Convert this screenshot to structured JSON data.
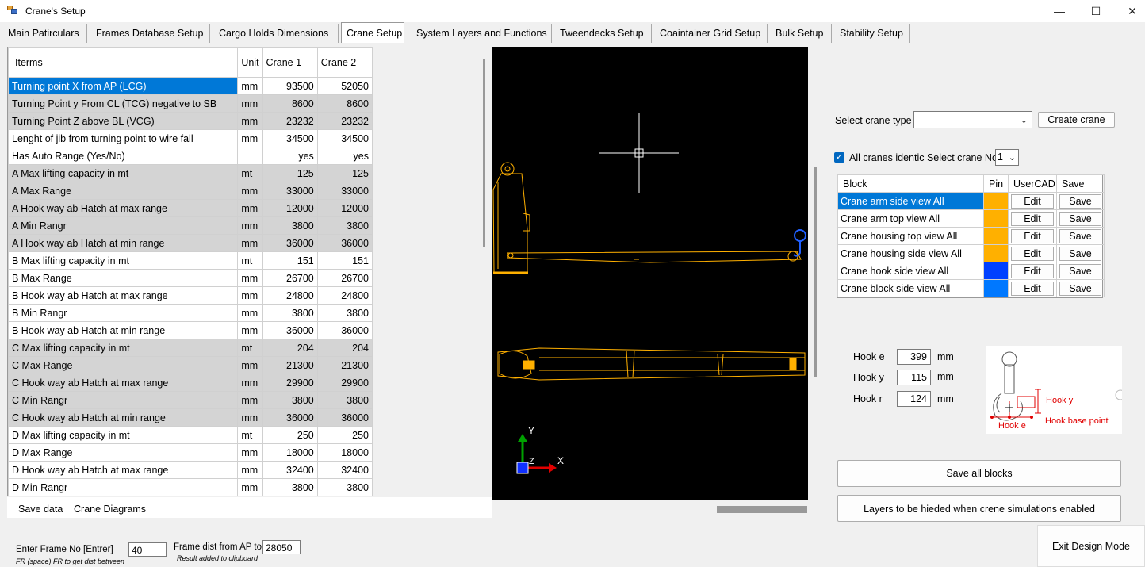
{
  "window": {
    "title": "Crane's Setup",
    "minimize": "—",
    "maximize": "☐",
    "close": "✕"
  },
  "tabs": [
    {
      "label": "Main Patirculars"
    },
    {
      "label": "Frames Database Setup"
    },
    {
      "label": "Cargo Holds Dimensions"
    },
    {
      "label": "Crane Setup"
    },
    {
      "label": "System Layers and Functions"
    },
    {
      "label": "Tweendecks Setup"
    },
    {
      "label": "Coaintainer Grid Setup"
    },
    {
      "label": "Bulk Setup"
    },
    {
      "label": "Stability Setup"
    }
  ],
  "grid": {
    "headers": {
      "items": "Iterms",
      "unit": "Unit",
      "crane1": "Crane 1",
      "crane2": "Crane 2"
    },
    "rows": [
      {
        "item": "Turning point X from AP (LCG)",
        "unit": "mm",
        "c1": "93500",
        "c2": "52050"
      },
      {
        "item": "Turning Point y From CL (TCG) negative to SB",
        "unit": "mm",
        "c1": "8600",
        "c2": "8600"
      },
      {
        "item": "Turning Point Z above BL (VCG)",
        "unit": "mm",
        "c1": "23232",
        "c2": "23232"
      },
      {
        "item": "Lenght of jib from turning point to wire fall",
        "unit": "mm",
        "c1": "34500",
        "c2": "34500"
      },
      {
        "item": "Has Auto Range (Yes/No)",
        "unit": "",
        "c1": "yes",
        "c2": "yes"
      },
      {
        "item": "A Max lifting capacity in mt",
        "unit": "mt",
        "c1": "125",
        "c2": "125"
      },
      {
        "item": "A Max Range",
        "unit": "mm",
        "c1": "33000",
        "c2": "33000"
      },
      {
        "item": "A Hook way ab Hatch at max range",
        "unit": "mm",
        "c1": "12000",
        "c2": "12000"
      },
      {
        "item": "A Min Rangr",
        "unit": "mm",
        "c1": "3800",
        "c2": "3800"
      },
      {
        "item": "A Hook way ab Hatch at min range",
        "unit": "mm",
        "c1": "36000",
        "c2": "36000"
      },
      {
        "item": "B Max lifting capacity in mt",
        "unit": "mt",
        "c1": "151",
        "c2": "151"
      },
      {
        "item": "B Max Range",
        "unit": "mm",
        "c1": "26700",
        "c2": "26700"
      },
      {
        "item": "B Hook way ab Hatch at max range",
        "unit": "mm",
        "c1": "24800",
        "c2": "24800"
      },
      {
        "item": "B Min Rangr",
        "unit": "mm",
        "c1": "3800",
        "c2": "3800"
      },
      {
        "item": "B Hook way ab Hatch at min range",
        "unit": "mm",
        "c1": "36000",
        "c2": "36000"
      },
      {
        "item": "C Max lifting capacity in mt",
        "unit": "mt",
        "c1": "204",
        "c2": "204"
      },
      {
        "item": "C Max Range",
        "unit": "mm",
        "c1": "21300",
        "c2": "21300"
      },
      {
        "item": "C Hook way ab Hatch at max range",
        "unit": "mm",
        "c1": "29900",
        "c2": "29900"
      },
      {
        "item": "C Min Rangr",
        "unit": "mm",
        "c1": "3800",
        "c2": "3800"
      },
      {
        "item": "C Hook way ab Hatch at min range",
        "unit": "mm",
        "c1": "36000",
        "c2": "36000"
      },
      {
        "item": "D Max lifting capacity in mt",
        "unit": "mt",
        "c1": "250",
        "c2": "250"
      },
      {
        "item": "D Max Range",
        "unit": "mm",
        "c1": "18000",
        "c2": "18000"
      },
      {
        "item": "D Hook way ab Hatch at max range",
        "unit": "mm",
        "c1": "32400",
        "c2": "32400"
      },
      {
        "item": "D Min Rangr",
        "unit": "mm",
        "c1": "3800",
        "c2": "3800"
      }
    ]
  },
  "footer": {
    "save_data": "Save data",
    "crane_diagrams": "Crane Diagrams"
  },
  "canvas": {
    "axis_y": "Y",
    "axis_x": "X",
    "axis_z": "Z"
  },
  "crane_panel": {
    "select_type_label": "Select crane type",
    "select_type_value": "",
    "create_crane": "Create crane",
    "identic_label": "All cranes identic Select crane No",
    "crane_no": "1",
    "block_headers": {
      "block": "Block",
      "pin": "Pin",
      "usercad": "UserCAD",
      "save": "Save"
    },
    "blocks": [
      {
        "name": "Crane arm side view All",
        "pin_color": "#ffb000",
        "edit": "Edit",
        "save": "Save"
      },
      {
        "name": "Crane arm top view All",
        "pin_color": "#ffb000",
        "edit": "Edit",
        "save": "Save"
      },
      {
        "name": "Crane housing top view All",
        "pin_color": "#ffb000",
        "edit": "Edit",
        "save": "Save"
      },
      {
        "name": "Crane housing side view All",
        "pin_color": "#ffb000",
        "edit": "Edit",
        "save": "Save"
      },
      {
        "name": "Crane hook side view All",
        "pin_color": "#0040ff",
        "edit": "Edit",
        "save": "Save"
      },
      {
        "name": "Crane block side view All",
        "pin_color": "#0078ff",
        "edit": "Edit",
        "save": "Save"
      }
    ],
    "hook": [
      {
        "label": "Hook e",
        "value": "399",
        "unit": "mm"
      },
      {
        "label": "Hook y",
        "value": "115",
        "unit": "mm"
      },
      {
        "label": "Hook r",
        "value": "124",
        "unit": "mm"
      }
    ],
    "hook_diagram": {
      "hook_y": "Hook y",
      "hook_base": "Hook base point",
      "hook_e": "Hook e"
    },
    "save_all": "Save all blocks",
    "layers_btn": "Layers to be hieded when crene simulations enabled"
  },
  "bottom": {
    "frame_no_label": "Enter Frame No [Entrer]",
    "frame_no_value": "40",
    "frame_hint": "FR (space) FR to get dist between",
    "dist_label": "Frame dist from AP to Fr",
    "dist_value": "28050",
    "dist_hint": "Result  added to clipboard",
    "exit_design": "Exit Design Mode"
  }
}
